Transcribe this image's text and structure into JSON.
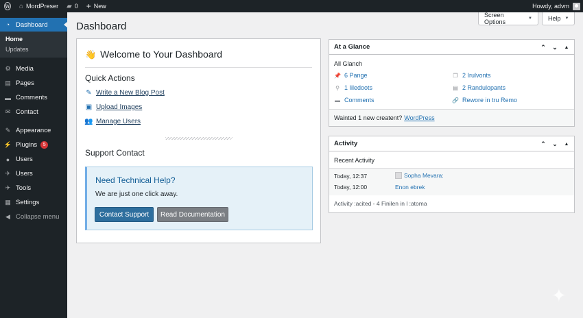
{
  "adminbar": {
    "site_name": "MordPreser",
    "comments_count": "0",
    "new_label": "New",
    "howdy": "Howdy, advm"
  },
  "sidebar": {
    "dashboard": "Dashboard",
    "submenu": [
      "Home",
      "Updates"
    ],
    "items": [
      {
        "label": "Media",
        "icon": "media-icon"
      },
      {
        "label": "Pages",
        "icon": "pages-icon"
      },
      {
        "label": "Comments",
        "icon": "comments-icon"
      },
      {
        "label": "Contact",
        "icon": "contact-icon"
      },
      {
        "label": "Appearance",
        "icon": "appearance-icon"
      },
      {
        "label": "Plugins",
        "icon": "plugins-icon",
        "badge": "5"
      },
      {
        "label": "Users",
        "icon": "users-icon"
      },
      {
        "label": "Users",
        "icon": "users-tools-icon"
      },
      {
        "label": "Tools",
        "icon": "tools-icon"
      },
      {
        "label": "Settings",
        "icon": "settings-icon"
      }
    ],
    "collapse": "Collapse menu"
  },
  "header": {
    "title": "Dashboard",
    "screen_options": "Screen Options",
    "help": "Help"
  },
  "welcome": {
    "wave": "👋",
    "title": "Welcome to Your Dashboard",
    "quick_actions_heading": "Quick Actions",
    "quick_actions": [
      {
        "label": "Write a New Blog Post",
        "icon": "pencil-icon"
      },
      {
        "label": "Upload Images",
        "icon": "image-icon"
      },
      {
        "label": "Manage Users",
        "icon": "users-icon"
      }
    ],
    "support_heading": "Support Contact",
    "help_box": {
      "title": "Need Technical Help?",
      "text": "We are just one click away.",
      "primary_button": "Contact Support",
      "secondary_button": "Read Documentation"
    }
  },
  "glance": {
    "title": "At a Glance",
    "subtitle": "All Glanch",
    "items": [
      {
        "label": "6 Pange",
        "icon": "pin-icon"
      },
      {
        "label": "2 Irulvonts",
        "icon": "copy-icon"
      },
      {
        "label": "1 Iiledoots",
        "icon": "location-icon"
      },
      {
        "label": "2 Randulopants",
        "icon": "list-icon"
      },
      {
        "label": "Comments",
        "icon": "comment-icon"
      },
      {
        "label": "Rewore in tru Remo",
        "icon": "link-icon"
      }
    ],
    "footer_text": "Wainted 1 new creatent?",
    "footer_link": "WordPress"
  },
  "activity": {
    "title": "Activity",
    "subtitle": "Recent Activity",
    "rows": [
      {
        "time": "Today, 12:37",
        "value": "Sopha Mevara:"
      },
      {
        "time": "Today, 12:00",
        "value": "Enon ebrek"
      }
    ],
    "footer": "Activity :acited - 4 Finilen in l :atoma"
  }
}
